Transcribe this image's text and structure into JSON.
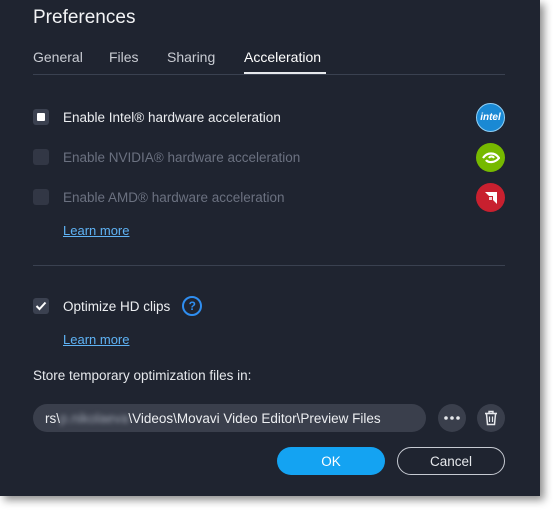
{
  "dialog": {
    "title": "Preferences",
    "colors": {
      "background": "#1f2430",
      "accent": "#14a3f2",
      "link": "#5fb3f5",
      "help": "#2f8ef0"
    }
  },
  "tabs": [
    {
      "label": "General",
      "active": false
    },
    {
      "label": "Files",
      "active": false
    },
    {
      "label": "Sharing",
      "active": false
    },
    {
      "label": "Acceleration",
      "active": true
    }
  ],
  "acceleration": {
    "intel": {
      "label": "Enable Intel® hardware acceleration",
      "checked": true,
      "enabled": true,
      "icon": "intel-logo-icon",
      "icon_text": "intel",
      "color": "#1a89d4"
    },
    "nvidia": {
      "label": "Enable NVIDIA® hardware acceleration",
      "checked": false,
      "enabled": false,
      "icon": "nvidia-logo-icon",
      "color": "#76b900"
    },
    "amd": {
      "label": "Enable AMD® hardware acceleration",
      "checked": false,
      "enabled": false,
      "icon": "amd-logo-icon",
      "color": "#c8202f"
    },
    "learn_more_1": "Learn more"
  },
  "optimize": {
    "label": "Optimize HD clips",
    "checked": true,
    "help_icon": "?",
    "learn_more_2": "Learn more"
  },
  "storage": {
    "label": "Store temporary optimization files in:",
    "path_prefix": "rs\\",
    "path_user": "p.nikolaeva",
    "path_rest": "\\Videos\\Movavi Video Editor\\Preview Files",
    "browse_icon": "more-icon",
    "delete_icon": "trash-icon"
  },
  "buttons": {
    "ok": "OK",
    "cancel": "Cancel"
  }
}
